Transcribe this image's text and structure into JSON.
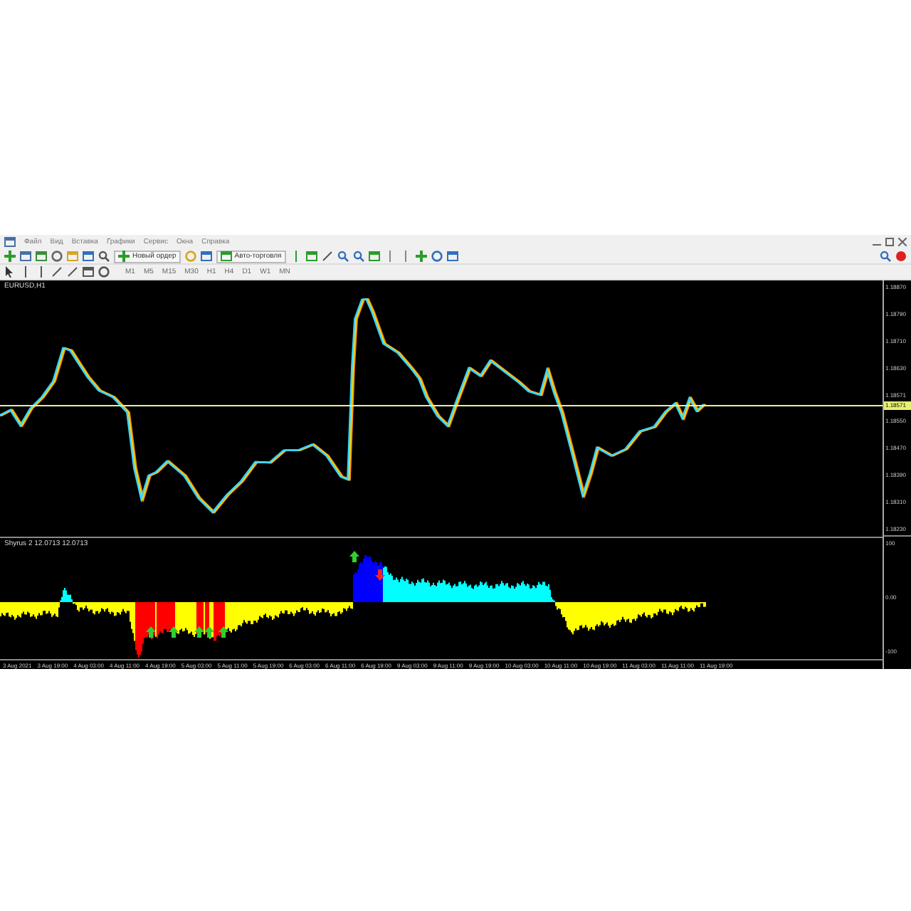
{
  "menu": [
    "Файл",
    "Вид",
    "Вставка",
    "Графики",
    "Сервис",
    "Окна",
    "Справка"
  ],
  "toolbar": {
    "new_order": "Новый ордер",
    "autotrading": "Авто-торговля",
    "timeframes": [
      "M1",
      "M5",
      "M15",
      "M30",
      "H1",
      "H4",
      "D1",
      "W1",
      "MN"
    ]
  },
  "chart": {
    "title": "EURUSD,H1",
    "price_axis": [
      "1.18870",
      "1.18790",
      "1.18710",
      "1.18630",
      "1.18571",
      "1.18550",
      "1.18470",
      "1.18390",
      "1.18310",
      "1.18230"
    ],
    "current_price": "1.18571",
    "indicator": {
      "title": "Shyrus 2 12.0713 12.0713",
      "axis": [
        "100",
        "0.00",
        "-100"
      ]
    },
    "time_axis": [
      "3 Aug 2021",
      "3 Aug 19:00",
      "4 Aug 03:00",
      "4 Aug 11:00",
      "4 Aug 19:00",
      "5 Aug 03:00",
      "5 Aug 11:00",
      "5 Aug 19:00",
      "6 Aug 03:00",
      "6 Aug 11:00",
      "6 Aug 19:00",
      "9 Aug 03:00",
      "9 Aug 11:00",
      "9 Aug 19:00",
      "10 Aug 03:00",
      "10 Aug 11:00",
      "10 Aug 19:00",
      "11 Aug 03:00",
      "11 Aug 11:00",
      "11 Aug 19:00"
    ]
  }
}
